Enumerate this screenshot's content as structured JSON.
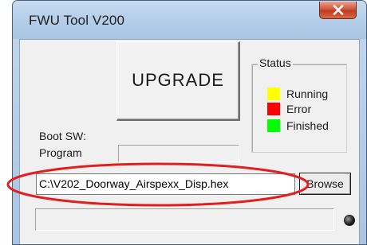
{
  "window": {
    "title": "FWU Tool V200"
  },
  "main": {
    "upgrade_label": "UPGRADE",
    "boot_sw_label": "Boot SW:",
    "program_label": "Program",
    "program_value": "",
    "file_path": "C:\\V202_Doorway_Airspexx_Disp.hex",
    "browse_label": "Browse",
    "progress": 0
  },
  "status": {
    "caption": "Status",
    "items": [
      {
        "label": "Running",
        "color": "#ffff00"
      },
      {
        "label": "Error",
        "color": "#ff0000"
      },
      {
        "label": "Finished",
        "color": "#00ff00"
      }
    ]
  },
  "icons": {
    "close": "close-icon",
    "indicator": "indicator-led-icon"
  },
  "colors": {
    "annotation": "#e0201e",
    "close_button": "#c94a30"
  }
}
